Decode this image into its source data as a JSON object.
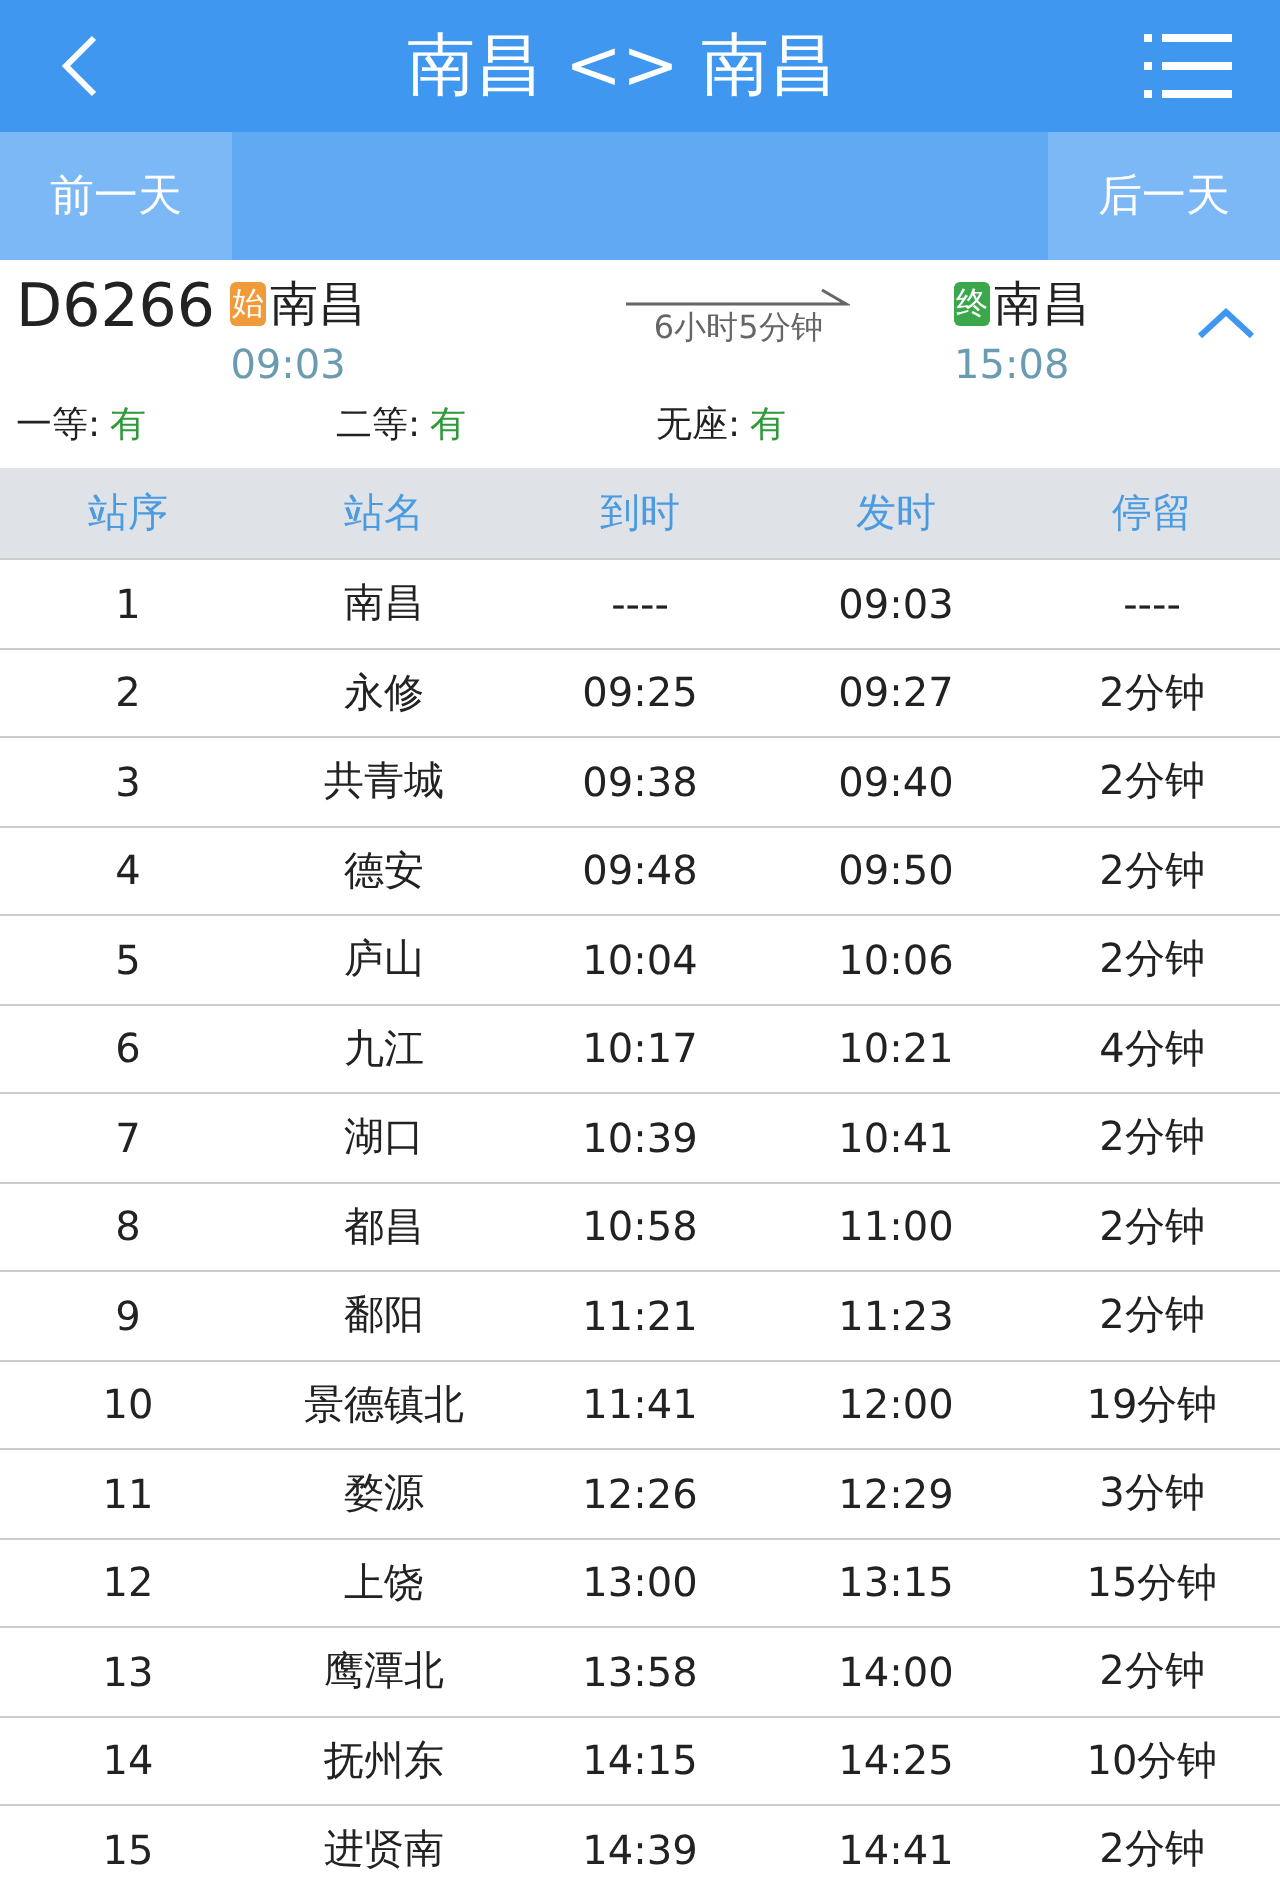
{
  "header": {
    "title": "南昌 <> 南昌"
  },
  "day_nav": {
    "prev": "前一天",
    "next": "后一天"
  },
  "train": {
    "number": "D6266",
    "start_tag": "始",
    "start_station": "南昌",
    "start_time": "09:03",
    "duration": "6小时5分钟",
    "end_tag": "终",
    "end_station": "南昌",
    "end_time": "15:08",
    "expanded": true,
    "seats": [
      {
        "label": "一等:",
        "value": "有"
      },
      {
        "label": "二等:",
        "value": "有"
      },
      {
        "label": "无座:",
        "value": "有"
      }
    ]
  },
  "table": {
    "columns": [
      "站序",
      "站名",
      "到时",
      "发时",
      "停留"
    ],
    "rows": [
      [
        "1",
        "南昌",
        "----",
        "09:03",
        "----"
      ],
      [
        "2",
        "永修",
        "09:25",
        "09:27",
        "2分钟"
      ],
      [
        "3",
        "共青城",
        "09:38",
        "09:40",
        "2分钟"
      ],
      [
        "4",
        "德安",
        "09:48",
        "09:50",
        "2分钟"
      ],
      [
        "5",
        "庐山",
        "10:04",
        "10:06",
        "2分钟"
      ],
      [
        "6",
        "九江",
        "10:17",
        "10:21",
        "4分钟"
      ],
      [
        "7",
        "湖口",
        "10:39",
        "10:41",
        "2分钟"
      ],
      [
        "8",
        "都昌",
        "10:58",
        "11:00",
        "2分钟"
      ],
      [
        "9",
        "鄱阳",
        "11:21",
        "11:23",
        "2分钟"
      ],
      [
        "10",
        "景德镇北",
        "11:41",
        "12:00",
        "19分钟"
      ],
      [
        "11",
        "婺源",
        "12:26",
        "12:29",
        "3分钟"
      ],
      [
        "12",
        "上饶",
        "13:00",
        "13:15",
        "15分钟"
      ],
      [
        "13",
        "鹰潭北",
        "13:58",
        "14:00",
        "2分钟"
      ],
      [
        "14",
        "抚州东",
        "14:15",
        "14:25",
        "10分钟"
      ],
      [
        "15",
        "进贤南",
        "14:39",
        "14:41",
        "2分钟"
      ]
    ]
  }
}
